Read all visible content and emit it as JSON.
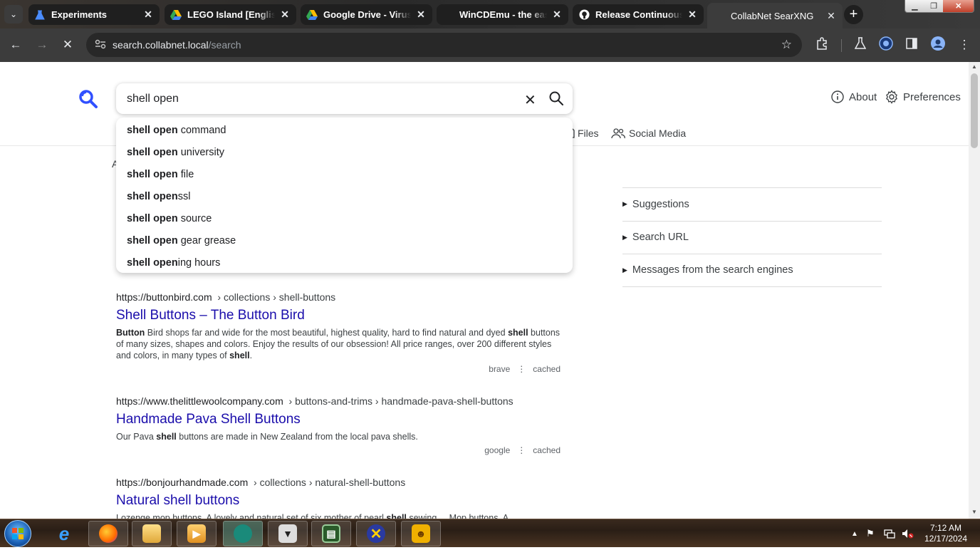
{
  "browser": {
    "tabs": [
      {
        "title": "Experiments",
        "icon": "experiments-icon",
        "color": "#4a8cff"
      },
      {
        "title": "LEGO Island [English (US)",
        "icon": "drive-icon",
        "color": "#34a853"
      },
      {
        "title": "Google Drive - Virus scan",
        "icon": "drive-icon",
        "color": "#34a853"
      },
      {
        "title": "WinCDEmu - the easiest",
        "icon": "blank-icon",
        "color": "#000000"
      },
      {
        "title": "Release Continuous bu",
        "icon": "github-icon",
        "color": "#ffffff"
      },
      {
        "title": "CollabNet SearXNG",
        "icon": "none",
        "color": "#ffffff"
      }
    ],
    "active_tab_index": 5,
    "address": {
      "host": "search.collabnet.local",
      "path": "/search"
    }
  },
  "header": {
    "search_value": "shell open",
    "about_label": "About",
    "preferences_label": "Preferences"
  },
  "categories": {
    "files_label": "Files",
    "social_label": "Social Media",
    "left_partial": "A"
  },
  "autocomplete": [
    {
      "bold": "shell open",
      "rest": " command"
    },
    {
      "bold": "shell open",
      "rest": " university"
    },
    {
      "bold": "shell open",
      "rest": " file"
    },
    {
      "bold": "shell open",
      "rest": "ssl"
    },
    {
      "bold": "shell open",
      "rest": " source"
    },
    {
      "bold": "shell open",
      "rest": " gear grease"
    },
    {
      "bold": "shell open",
      "rest": "ing hours"
    }
  ],
  "sidebar": [
    {
      "label": "Suggestions"
    },
    {
      "label": "Search URL"
    },
    {
      "label": "Messages from the search engines"
    }
  ],
  "results": [
    {
      "host": "https://buttonbird.com",
      "path": "› collections › shell-buttons",
      "title": "Shell Buttons – The Button Bird",
      "snippet_html": "<b>Button</b> Bird shops far and wide for the most beautiful, highest quality, hard to find natural and dyed <b>shell</b> buttons of many sizes, shapes and colors. Enjoy the results of our obsession! All price ranges, over 200 different styles and colors, in many types of <b>shell</b>.",
      "engine": "brave",
      "cached": "cached"
    },
    {
      "host": "https://www.thelittlewoolcompany.com",
      "path": "› buttons-and-trims › handmade-pava-shell-buttons",
      "title": "Handmade Pava Shell Buttons",
      "snippet_html": "Our Pava <b>shell</b> buttons are made in New Zealand from the local pava shells.",
      "engine": "google",
      "cached": "cached"
    },
    {
      "host": "https://bonjourhandmade.com",
      "path": "› collections › natural-shell-buttons",
      "title": "Natural shell buttons",
      "snippet_html": "Lozenge mop buttons. A lovely and natural set of six mother of pearl <b>shell</b> sewing ... Mop buttons. A",
      "engine": "",
      "cached": ""
    }
  ],
  "taskbar": {
    "clock_time": "7:12 AM",
    "clock_date": "12/17/2024",
    "apps": [
      "internet-explorer-icon",
      "firefox-icon",
      "file-explorer-icon",
      "media-player-icon",
      "chat-app-icon",
      "fox-app-icon",
      "terminal-app-icon",
      "x-app-icon",
      "lion-app-icon"
    ]
  }
}
